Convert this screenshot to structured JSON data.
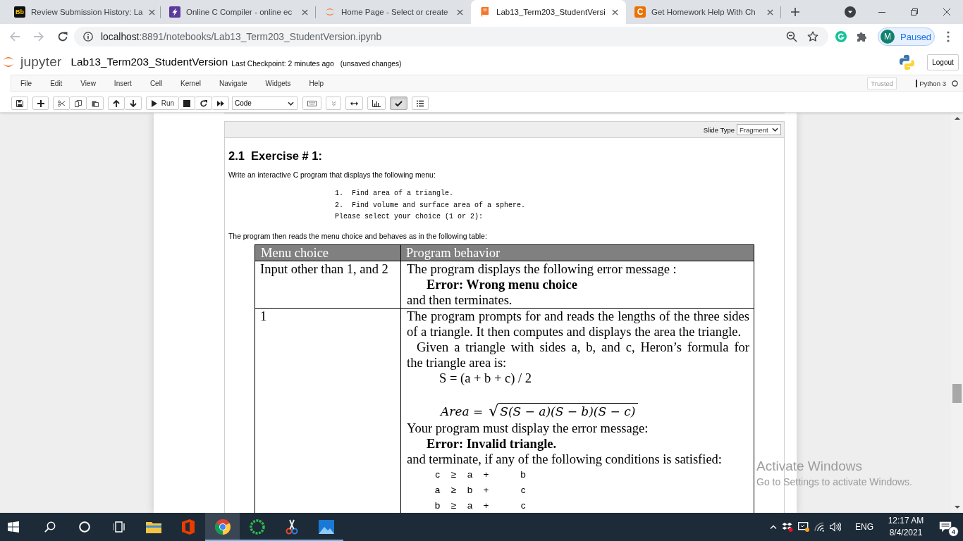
{
  "browser": {
    "tabs": [
      {
        "kind": "blackboard",
        "icon_text": "Bb",
        "title": "Review Submission History: La",
        "selected": false
      },
      {
        "kind": "bolt",
        "title": "Online C Compiler - online ec",
        "selected": false
      },
      {
        "kind": "jupyter",
        "title": "Home Page - Select or create",
        "selected": false
      },
      {
        "kind": "notebook",
        "title": "Lab13_Term203_StudentVersi",
        "selected": true
      },
      {
        "kind": "chegg",
        "icon_text": "C",
        "title": "Get Homework Help With Ch",
        "selected": false
      }
    ],
    "nav": {
      "back_disabled": true,
      "forward_disabled": true
    },
    "address": {
      "host": "localhost",
      "path": ":8891/notebooks/Lab13_Term203_StudentVersion.ipynb"
    },
    "profile": {
      "initial": "M",
      "status": "Paused"
    }
  },
  "notebook_header": {
    "logo_text": "jupyter",
    "name": "Lab13_Term203_StudentVersion",
    "checkpoint": "Last Checkpoint: 2 minutes ago",
    "save_status": "(unsaved changes)",
    "logout": "Logout"
  },
  "menubar": {
    "items": [
      "File",
      "Edit",
      "View",
      "Insert",
      "Cell",
      "Kernel",
      "Navigate",
      "Widgets",
      "Help"
    ],
    "trusted": "Trusted",
    "kernel": "Python 3"
  },
  "toolbar": {
    "run": "Run",
    "cell_type": "Code",
    "cell_toolbar_pressed": true
  },
  "cell": {
    "slide_type_label": "Slide Type",
    "slide_type": "Fragment",
    "heading": "2.1  Exercise # 1:",
    "intro": "Write an interactive C program that displays the following menu:",
    "menu_code": [
      "1.  Find area of a triangle.",
      "2.  Find volume and surface area of a sphere.",
      "Please select your choice (1 or 2):"
    ],
    "table_intro": "The program then reads the menu choice and behaves as in the following table:",
    "table": {
      "columns": [
        "Menu choice",
        "Program behavior"
      ],
      "rows": [
        {
          "choice": "Input other than 1, and 2",
          "behavior": [
            {
              "kind": "line",
              "text": "The program displays the following error message :"
            },
            {
              "kind": "error",
              "text": "Error: Wrong menu choice"
            },
            {
              "kind": "line",
              "text": "and then terminates."
            }
          ]
        },
        {
          "choice": "1",
          "behavior": [
            {
              "kind": "paragraph",
              "lines": [
                "The program prompts for and reads the lengths of the three sides",
                "of a triangle. It then computes and displays the area the triangle."
              ]
            },
            {
              "kind": "indented_paragraph",
              "lines": [
                "Given a triangle with sides a, b, and c, Heron’s formula for",
                "the triangle area is:"
              ]
            },
            {
              "kind": "equation",
              "text": "S = (a + b + c) / 2"
            },
            {
              "kind": "radical",
              "lhs": "Area =",
              "radical": "√",
              "radicand": "S(S − a)(S − b)(S − c)"
            },
            {
              "kind": "line",
              "text": "Your program must display the error message:"
            },
            {
              "kind": "error",
              "text": "Error: Invalid triangle."
            },
            {
              "kind": "line",
              "text": "and terminate, if any of the following conditions is satisfied:"
            },
            {
              "kind": "condition",
              "terms": [
                "c",
                "≥",
                "a",
                "+",
                "b"
              ]
            },
            {
              "kind": "condition",
              "terms": [
                "a",
                "≥",
                "b",
                "+",
                "c"
              ]
            },
            {
              "kind": "condition",
              "terms": [
                "b",
                "≥",
                "a",
                "+",
                "c"
              ]
            }
          ]
        }
      ]
    }
  },
  "activation_notice": {
    "title": "Activate Windows",
    "detail": "Go to Settings to activate Windows."
  },
  "taskbar": {
    "apps": [
      {
        "kind": "explorer",
        "running": false,
        "selected": false
      },
      {
        "kind": "office",
        "running": false,
        "selected": false
      },
      {
        "kind": "chrome",
        "running": true,
        "selected": true
      },
      {
        "kind": "ring",
        "running": true,
        "selected": false
      },
      {
        "kind": "snipping",
        "running": true,
        "selected": false
      },
      {
        "kind": "photos",
        "running": true,
        "selected": false
      }
    ],
    "language": "ENG",
    "time": "12:17 AM",
    "date": "8/4/2021",
    "notifications": "4"
  }
}
